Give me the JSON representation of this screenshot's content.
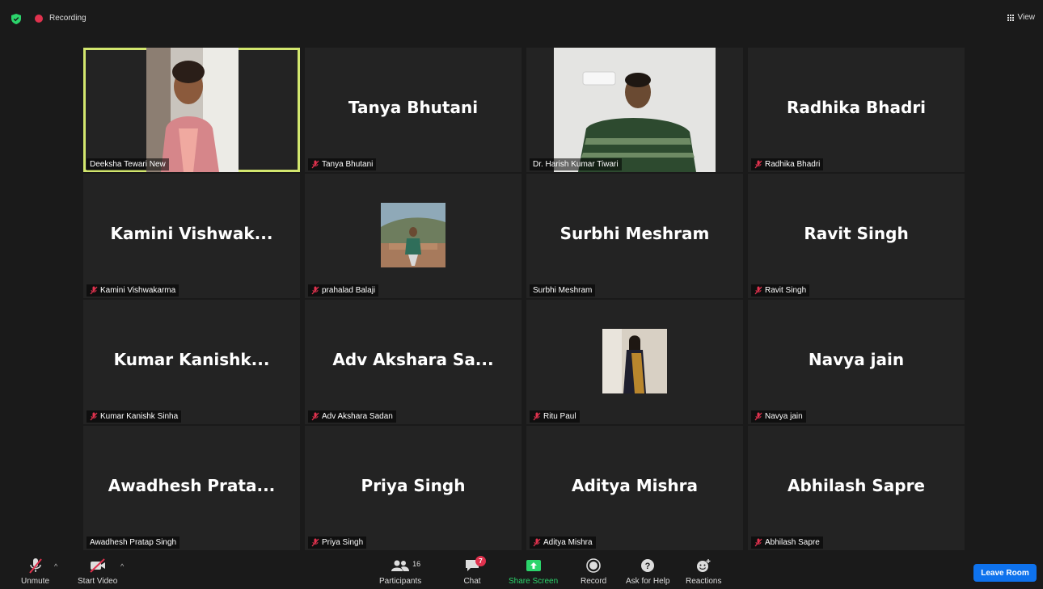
{
  "topbar": {
    "recording_label": "Recording",
    "view_label": "View"
  },
  "tiles": [
    {
      "big": "",
      "label": "Deeksha Tewari New",
      "muted": false
    },
    {
      "big": "Tanya Bhutani",
      "label": "Tanya Bhutani",
      "muted": true
    },
    {
      "big": "",
      "label": "Dr. Harish Kumar Tiwari",
      "muted": false
    },
    {
      "big": "Radhika Bhadri",
      "label": "Radhika Bhadri",
      "muted": true
    },
    {
      "big": "Kamini  Vishwak...",
      "label": "Kamini Vishwakarma",
      "muted": true
    },
    {
      "big": "",
      "label": "prahalad Balaji",
      "muted": true
    },
    {
      "big": "Surbhi Meshram",
      "label": "Surbhi Meshram",
      "muted": false
    },
    {
      "big": "Ravit Singh",
      "label": "Ravit Singh",
      "muted": true
    },
    {
      "big": "Kumar  Kanishk...",
      "label": "Kumar Kanishk Sinha",
      "muted": true
    },
    {
      "big": "Adv Akshara Sa...",
      "label": "Adv Akshara Sadan",
      "muted": true
    },
    {
      "big": "",
      "label": "Ritu Paul",
      "muted": true
    },
    {
      "big": "Navya jain",
      "label": "Navya jain",
      "muted": true
    },
    {
      "big": "Awadhesh  Prata...",
      "label": "Awadhesh Pratap Singh",
      "muted": false
    },
    {
      "big": "Priya Singh",
      "label": "Priya Singh",
      "muted": true
    },
    {
      "big": "Aditya Mishra",
      "label": "Aditya Mishra",
      "muted": true
    },
    {
      "big": "Abhilash Sapre",
      "label": "Abhilash Sapre",
      "muted": true
    }
  ],
  "toolbar": {
    "unmute": "Unmute",
    "start_video": "Start Video",
    "participants": "Participants",
    "participants_count": "16",
    "chat": "Chat",
    "chat_badge": "7",
    "share_screen": "Share Screen",
    "record": "Record",
    "ask_for_help": "Ask for Help",
    "reactions": "Reactions",
    "leave_room": "Leave Room"
  },
  "colors": {
    "active_speaker_border": "#d2e66e",
    "share_screen_green": "#2bd46b",
    "leave_button_blue": "#0e72ed",
    "recording_red": "#e0324e",
    "muted_red": "#e0324e"
  }
}
